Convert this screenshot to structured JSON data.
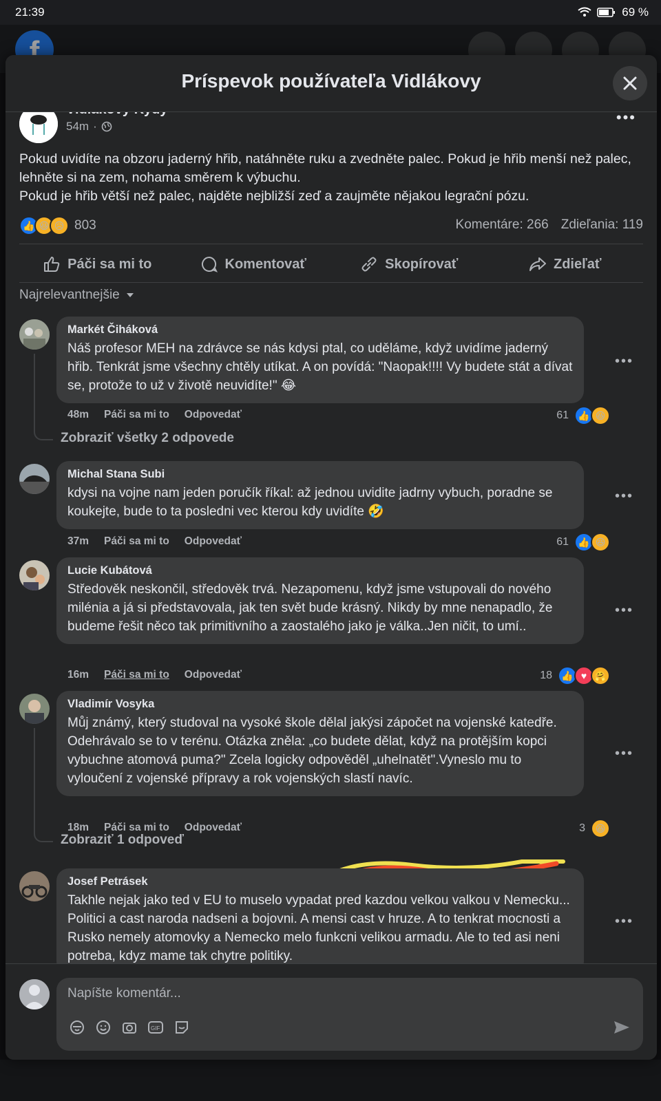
{
  "status_bar": {
    "time": "21:39",
    "battery": "69 %"
  },
  "modal": {
    "title": "Príspevok používateľa Vidlákovy"
  },
  "post": {
    "author": "Vidlákovy Kydy",
    "time": "54m",
    "text_lines": [
      "Pokud uvidíte na obzoru jaderný hřib, natáhněte ruku a zvedněte palec. Pokud je hřib menší než palec, lehněte si na zem, nohama směrem k výbuchu.",
      "Pokud je hřib větší než palec, najděte nejbližší zeď a zaujměte nějakou legrační pózu."
    ],
    "reaction_count": "803",
    "comments_label": "Komentáre: 266",
    "shares_label": "Zdieľania: 119"
  },
  "actions": {
    "like": "Páči sa mi to",
    "comment": "Komentovať",
    "copy": "Skopírovať",
    "share": "Zdieľať"
  },
  "sort_label": "Najrelevantnejšie",
  "comments": [
    {
      "name": "Markét Čiháková",
      "text": "Náš profesor MEH na zdrávce se nás kdysi ptal, co uděláme, když uvidíme jaderný hřib. Tenkrát jsme všechny chtěly utíkat. A on povídá: \"Naopak!!!! Vy budete stát a dívat se, protože to už v životě neuvidíte!\" 😂",
      "time": "48m",
      "like": "Páči sa mi to",
      "reply": "Odpovedať",
      "count": "61",
      "replies": "Zobraziť všetky 2 odpovede"
    },
    {
      "name": "Michal Stana Subi",
      "text": "kdysi na vojne nam jeden poručík říkal: až jednou uvidite jadrny vybuch, poradne se koukejte, bude to ta posledni vec kterou kdy uvidíte 🤣",
      "time": "37m",
      "like": "Páči sa mi to",
      "reply": "Odpovedať",
      "count": "61"
    },
    {
      "name": "Lucie Kubátová",
      "text": "Středověk neskončil, středověk trvá. Nezapomenu, když jsme vstupovali do nového milénia a já si představovala, jak ten svět bude krásný. Nikdy by mne nenapadlo, že budeme řešit něco tak primitivního a zaostalého jako je válka..Jen ničit, to umí..",
      "time": "16m",
      "like": "Páči sa mi to",
      "reply": "Odpovedať",
      "count": "18"
    },
    {
      "name": "Vladimír Vosyka",
      "text": "Můj známý, který studoval na vysoké škole dělal jakýsi zápočet na vojenské katedře. Odehrávalo se to v terénu. Otázka zněla: „co budete dělat, když na protějším kopci vybuchne atomová puma?\" Zcela logicky odpověděl „uhelnatět\".Vyneslo mu to vyloučení z vojenské přípravy a rok vojenských slastí navíc.",
      "time": "18m",
      "like": "Páči sa mi to",
      "reply": "Odpovedať",
      "count": "3",
      "replies": "Zobraziť 1 odpoveď"
    },
    {
      "name": "Josef Petrásek",
      "text": "Takhle nejak jako ted v EU to muselo vypadat pred kazdou velkou valkou v Nemecku... Politici a cast naroda nadseni a bojovni. A mensi cast v hruze. A to tenkrat mocnosti a Rusko nemely atomovky a Nemecko melo funkcni velikou armadu. Ale to ted asi neni potreba, kdyz mame tak chytre politiky."
    }
  ],
  "composer": {
    "placeholder": "Napíšte komentár..."
  },
  "colors": {
    "accent": "#1877f2",
    "bg": "#242526",
    "bubble": "#3a3b3c",
    "text": "#e4e6eb",
    "muted": "#b0b3b8"
  }
}
